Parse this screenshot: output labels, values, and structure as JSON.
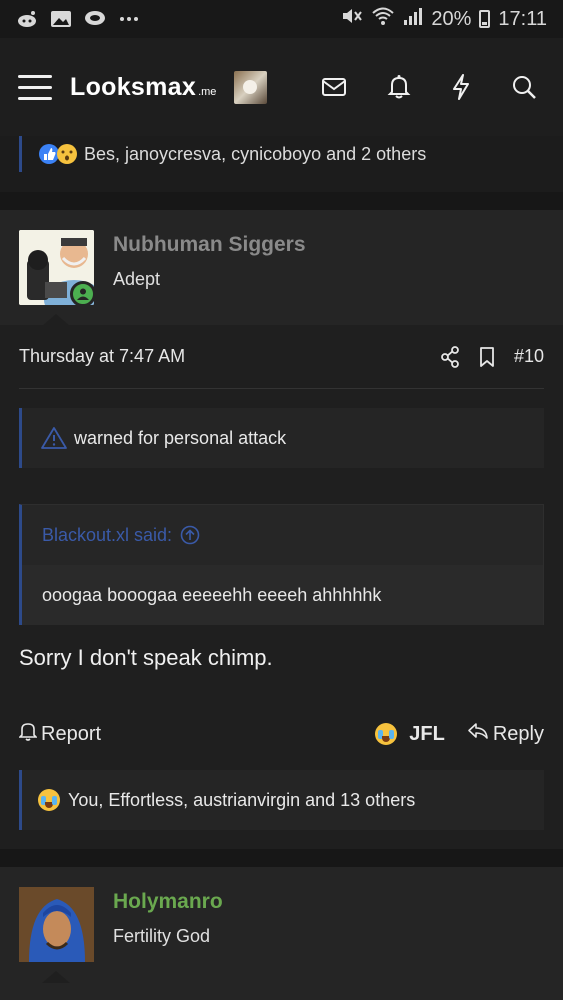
{
  "status_bar": {
    "battery": "20%",
    "time": "17:11"
  },
  "header": {
    "logo_main": "Looksmax",
    "logo_suffix": ".me"
  },
  "previous_post": {
    "reactions_text": "Bes, janoycresva, cynicoboyo and 2 others"
  },
  "post": {
    "username": "Nubhuman Siggers",
    "user_title": "Adept",
    "timestamp": "Thursday at 7:47 AM",
    "post_number": "#10",
    "warning_text": "warned for personal attack",
    "quote_author": "Blackout.xl said:",
    "quote_text": "ooogaa booogaa eeeeehh eeeeh ahhhhhk",
    "message": "Sorry I don't speak chimp.",
    "report_label": "Report",
    "reaction_label": "JFL",
    "reply_label": "Reply",
    "reactions_text": "You, Effortless, austrianvirgin and 13 others"
  },
  "next_post": {
    "username": "Holymanro",
    "user_title": "Fertility God"
  },
  "colors": {
    "accent_blue": "#2d4a8a",
    "online_green": "#4caf50",
    "username_green": "#6aa84f"
  }
}
